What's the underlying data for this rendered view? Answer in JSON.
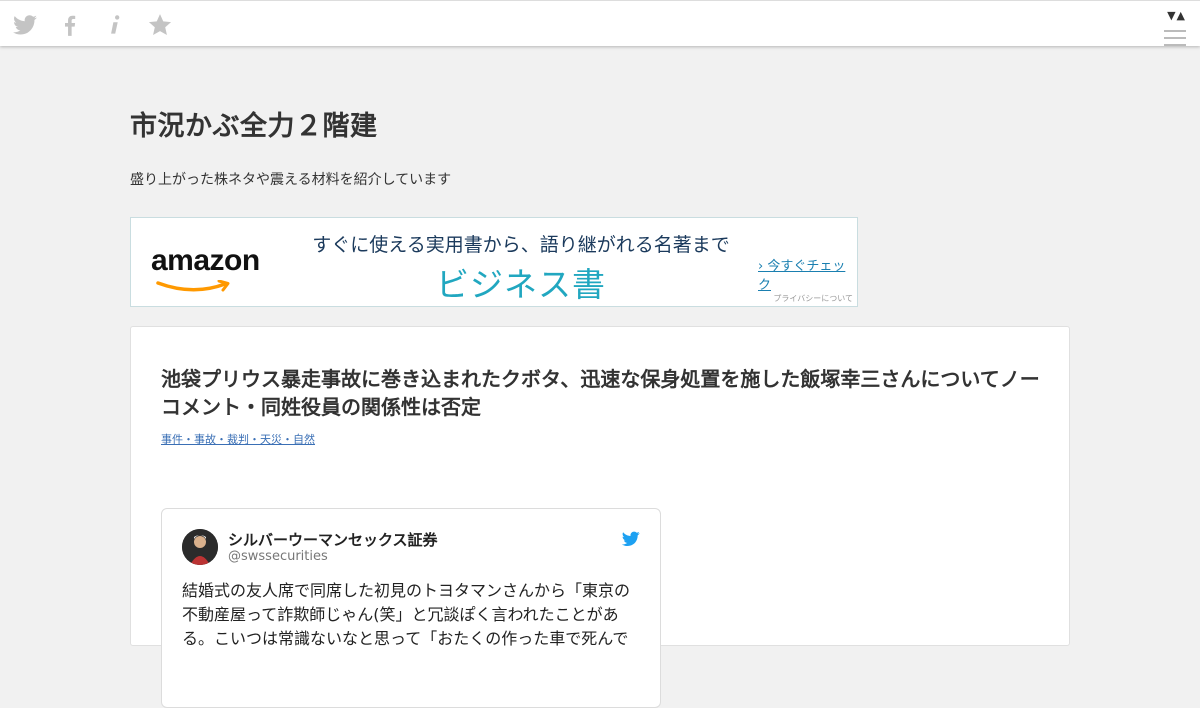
{
  "topbar": {
    "icons": [
      "twitter-icon",
      "facebook-icon",
      "info-icon",
      "star-icon"
    ],
    "arrows": "▼▲"
  },
  "site": {
    "title": "市況かぶ全力２階建",
    "description": "盛り上がった株ネタや震える材料を紹介しています"
  },
  "ad": {
    "brand": "amazon",
    "tagline": "すぐに使える実用書から、語り継がれる名著まで",
    "headline": "ビジネス書",
    "cta": "› 今すぐチェック",
    "privacy": "プライバシーについて"
  },
  "post": {
    "title": "池袋プリウス暴走事故に巻き込まれたクボタ、迅速な保身処置を施した飯塚幸三さんについてノーコメント・同姓役員の関係性は否定",
    "categories": "事件・事故・裁判・天災・自然"
  },
  "tweet": {
    "name": "シルバーウーマンセックス証券",
    "handle": "@swssecurities",
    "text": "結婚式の友人席で同席した初見のトヨタマンさんから「東京の不動産屋って詐欺師じゃん(笑」と冗談ぽく言われたことがある。こいつは常識ないなと思って「おたくの作った車で死んで"
  },
  "colors": {
    "page_bg": "#f1f1f1",
    "ad_headline": "#21a7c0",
    "ad_tagline": "#1b3a5c",
    "link": "#3a6fb5",
    "twitter_blue": "#1da1f2",
    "amazon_orange": "#f90"
  }
}
